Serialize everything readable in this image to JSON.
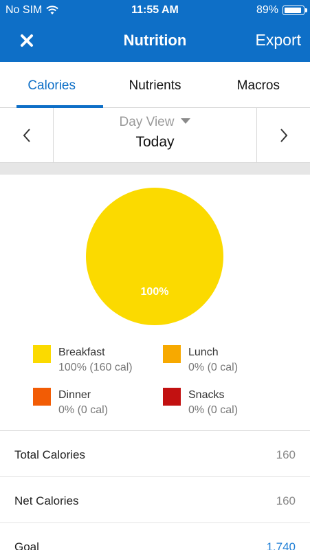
{
  "status_bar": {
    "carrier": "No SIM",
    "time": "11:55 AM",
    "battery": "89%"
  },
  "nav": {
    "title": "Nutrition",
    "export_label": "Export",
    "close_icon": "close-icon"
  },
  "tabs": [
    {
      "label": "Calories",
      "active": true
    },
    {
      "label": "Nutrients",
      "active": false
    },
    {
      "label": "Macros",
      "active": false
    }
  ],
  "date_nav": {
    "view": "Day View",
    "day": "Today"
  },
  "chart_data": {
    "type": "pie",
    "slices": [
      {
        "name": "Breakfast",
        "value": 100,
        "label": "100%",
        "color": "#FBDA00"
      },
      {
        "name": "Lunch",
        "value": 0,
        "color": "#F7A900"
      },
      {
        "name": "Dinner",
        "value": 0,
        "color": "#F25C05"
      },
      {
        "name": "Snacks",
        "value": 0,
        "color": "#C21111"
      }
    ]
  },
  "legend": [
    {
      "name": "Breakfast",
      "value": "100% (160 cal)",
      "color": "#FBDA00"
    },
    {
      "name": "Lunch",
      "value": "0% (0 cal)",
      "color": "#F7A900"
    },
    {
      "name": "Dinner",
      "value": "0% (0 cal)",
      "color": "#F25C05"
    },
    {
      "name": "Snacks",
      "value": "0% (0 cal)",
      "color": "#C21111"
    }
  ],
  "summary": [
    {
      "label": "Total Calories",
      "value": "160"
    },
    {
      "label": "Net Calories",
      "value": "160"
    },
    {
      "label": "Goal",
      "value": "1,740"
    }
  ],
  "colors": {
    "brand": "#0E6FC7",
    "link": "#1F7FD6"
  }
}
